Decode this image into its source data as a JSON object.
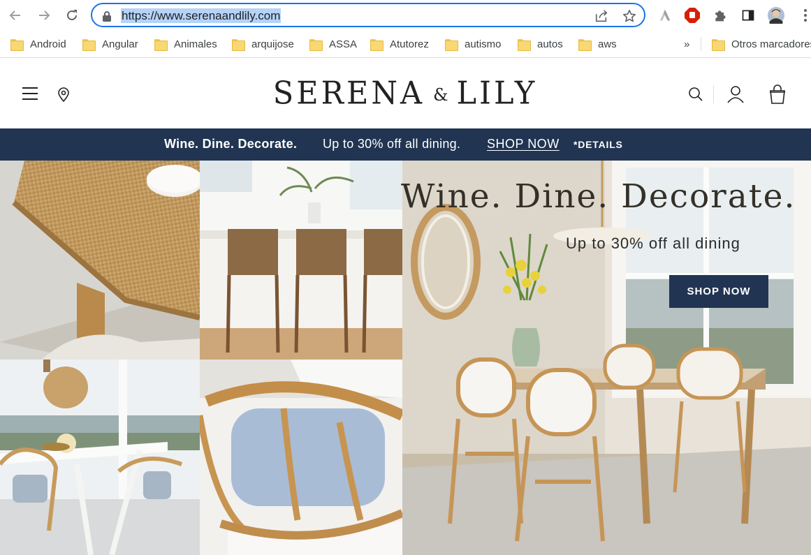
{
  "browser": {
    "url": "https://www.serenaandlily.com",
    "icons": {
      "back": "back-arrow-icon",
      "forward": "forward-arrow-icon",
      "reload": "reload-icon",
      "lock": "lock-icon",
      "share": "share-icon",
      "star": "bookmark-star-icon",
      "extensions": [
        "ink-extension-icon",
        "adblock-extension-icon",
        "puzzle-extensions-icon",
        "side-panel-icon",
        "profile-avatar-icon",
        "kebab-menu-icon"
      ]
    },
    "accent": "#1a73e8"
  },
  "bookmarks": {
    "items": [
      {
        "label": "Android"
      },
      {
        "label": "Angular"
      },
      {
        "label": "Animales"
      },
      {
        "label": "arquijose"
      },
      {
        "label": "ASSA"
      },
      {
        "label": "Atutorez"
      },
      {
        "label": "autismo"
      },
      {
        "label": "autos"
      },
      {
        "label": "aws"
      }
    ],
    "overflow": "»",
    "other": "Otros marcadores"
  },
  "site": {
    "logo_left": "SERENA",
    "logo_amp": "&",
    "logo_right": "LILY",
    "brand_color": "#213552",
    "icons": [
      "hamburger-menu-icon",
      "location-pin-icon",
      "search-icon",
      "account-icon",
      "shopping-bag-icon"
    ]
  },
  "promo": {
    "title": "Wine. Dine. Decorate.",
    "text": "Up to 30% off all dining.",
    "link": "SHOP NOW",
    "details": "*DETAILS"
  },
  "hero": {
    "title": "Wine. Dine. Decorate.",
    "subtitle": "Up to 30% off all dining",
    "cta": "SHOP NOW"
  }
}
